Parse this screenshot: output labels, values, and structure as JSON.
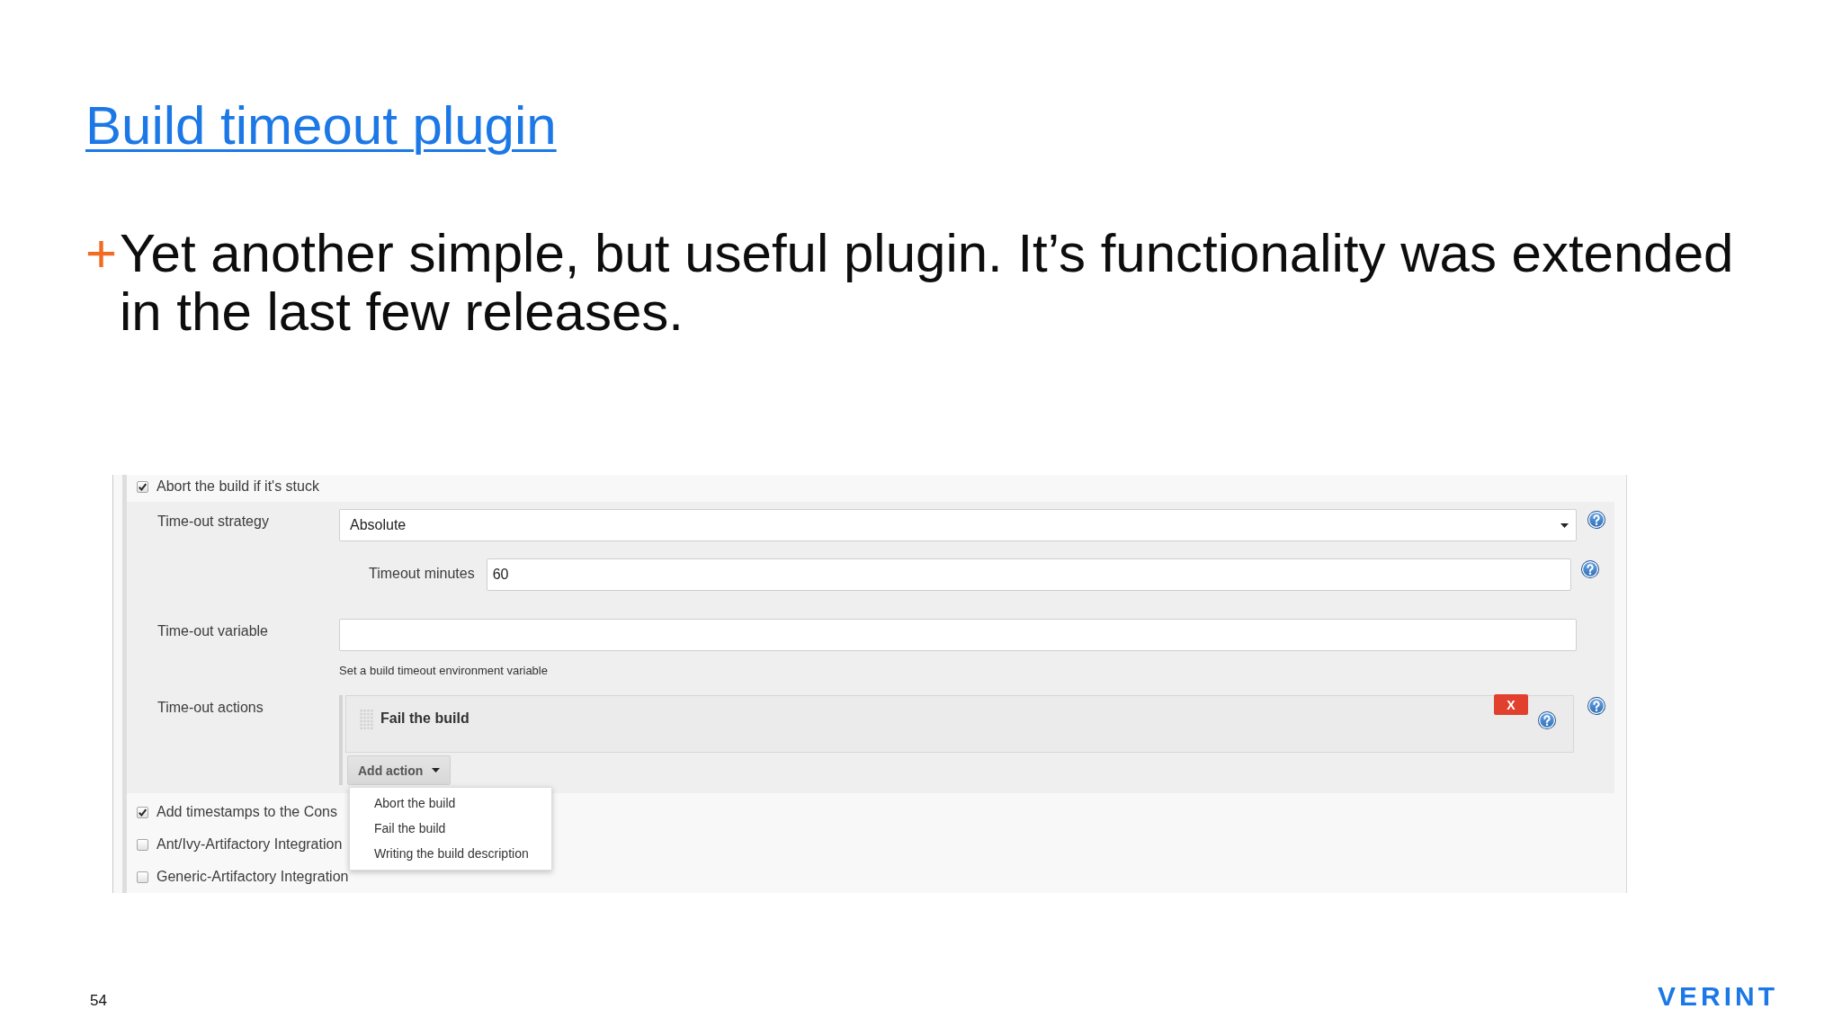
{
  "slide": {
    "title": "Build timeout plugin",
    "bullets": [
      {
        "marker": "+",
        "text": "Yet another simple, but useful plugin. It’s functionality was extended in the last few releases."
      }
    ]
  },
  "config_panel": {
    "main_option": {
      "label": "Abort the build if it's stuck",
      "checked": true
    },
    "fields": [
      {
        "kind": "select",
        "label": "Time-out strategy",
        "value": "Absolute",
        "help": true,
        "children": [
          {
            "kind": "text",
            "label": "Timeout minutes",
            "value": "60",
            "help": true
          }
        ]
      },
      {
        "kind": "text",
        "label": "Time-out variable",
        "help": false,
        "hint": "Set a build timeout environment variable"
      },
      {
        "kind": "actions",
        "label": "Time-out actions",
        "help": true,
        "items": [
          {
            "title": "Fail the build",
            "delete_label": "X",
            "help": true
          }
        ],
        "add_button": {
          "label": "Add action",
          "expanded": true
        },
        "menu_items": [
          "Abort the build",
          "Fail the build",
          "Writing the build description"
        ]
      }
    ],
    "options": [
      {
        "label": "Add timestamps to the Cons",
        "checked": true
      },
      {
        "label": "Ant/Ivy-Artifactory Integration",
        "checked": false
      },
      {
        "label": "Generic-Artifactory Integration",
        "checked": false
      }
    ]
  },
  "footer": {
    "page_number": "54",
    "logo": "VERINT"
  }
}
